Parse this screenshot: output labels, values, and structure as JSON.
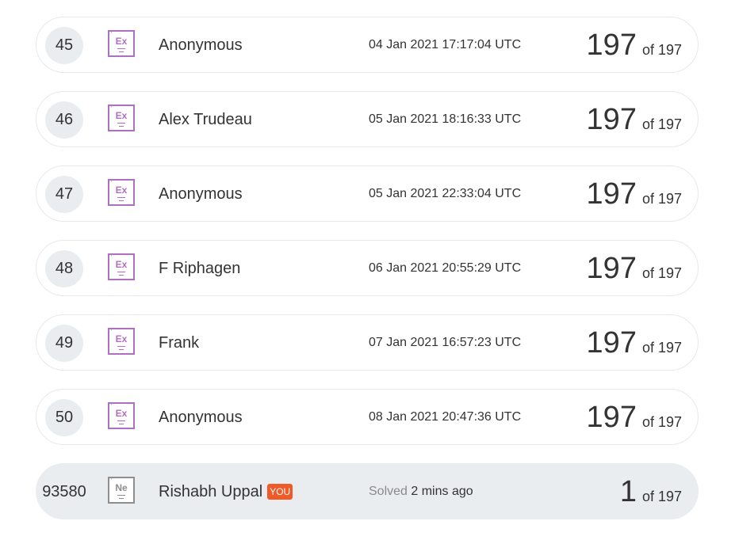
{
  "rows": [
    {
      "rank": "45",
      "element_symbol": "Ex",
      "element_number": "'",
      "name": "Anonymous",
      "time": "04 Jan 2021 17:17:04 UTC",
      "score": "197",
      "of_text": "of 197"
    },
    {
      "rank": "46",
      "element_symbol": "Ex",
      "element_number": "'",
      "name": "Alex Trudeau",
      "time": "05 Jan 2021 18:16:33 UTC",
      "score": "197",
      "of_text": "of 197"
    },
    {
      "rank": "47",
      "element_symbol": "Ex",
      "element_number": "'",
      "name": "Anonymous",
      "time": "05 Jan 2021 22:33:04 UTC",
      "score": "197",
      "of_text": "of 197"
    },
    {
      "rank": "48",
      "element_symbol": "Ex",
      "element_number": "'",
      "name": "F Riphagen",
      "time": "06 Jan 2021 20:55:29 UTC",
      "score": "197",
      "of_text": "of 197"
    },
    {
      "rank": "49",
      "element_symbol": "Ex",
      "element_number": "'",
      "name": "Frank",
      "time": "07 Jan 2021 16:57:23 UTC",
      "score": "197",
      "of_text": "of 197"
    },
    {
      "rank": "50",
      "element_symbol": "Ex",
      "element_number": "'",
      "name": "Anonymous",
      "time": "08 Jan 2021 20:47:36 UTC",
      "score": "197",
      "of_text": "of 197"
    }
  ],
  "current_user": {
    "rank": "93580",
    "element_symbol": "Ne",
    "element_number": "'",
    "name": "Rishabh Uppal",
    "you_badge": "YOU",
    "solved_label": "Solved",
    "solved_time": "2 mins ago",
    "score": "1",
    "of_text": "of 197"
  },
  "colors": {
    "expert_badge": "#b06fc0",
    "newbie_badge": "#8e8e8e",
    "you_badge": "#f05a28",
    "current_row_bg": "#e9edf0"
  }
}
